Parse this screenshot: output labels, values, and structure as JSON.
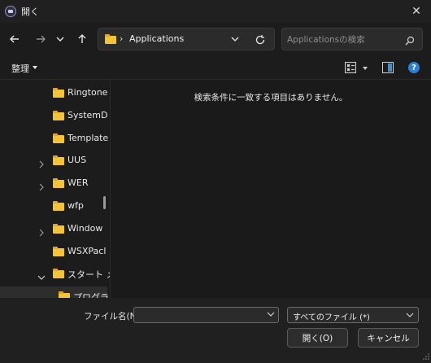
{
  "window": {
    "title": "開く",
    "close_icon": "close-icon"
  },
  "nav": {
    "back_icon": "back-arrow-icon",
    "forward_icon": "forward-arrow-icon",
    "recent_icon": "chevron-down-icon",
    "up_icon": "up-arrow-icon",
    "breadcrumb_sep": "›",
    "breadcrumb": "Applications",
    "search_placeholder": "Applicationsの検索"
  },
  "toolbar": {
    "organize_label": "整理",
    "help_label": "?"
  },
  "sidebar": {
    "items": [
      {
        "label": "Ringtone",
        "expandable": false,
        "expanded": false,
        "indent": 1
      },
      {
        "label": "SystemD",
        "expandable": false,
        "expanded": false,
        "indent": 1
      },
      {
        "label": "Template",
        "expandable": false,
        "expanded": false,
        "indent": 1
      },
      {
        "label": "UUS",
        "expandable": true,
        "expanded": false,
        "indent": 1
      },
      {
        "label": "WER",
        "expandable": true,
        "expanded": false,
        "indent": 1
      },
      {
        "label": "wfp",
        "expandable": false,
        "expanded": false,
        "indent": 1
      },
      {
        "label": "Window",
        "expandable": true,
        "expanded": false,
        "indent": 1
      },
      {
        "label": "WSXPacl",
        "expandable": false,
        "expanded": false,
        "indent": 1
      },
      {
        "label": "スタート メ",
        "expandable": true,
        "expanded": true,
        "indent": 1
      },
      {
        "label": "プログラ",
        "expandable": true,
        "expanded": true,
        "indent": 2
      }
    ]
  },
  "main": {
    "empty_message": "検索条件に一致する項目はありません。"
  },
  "footer": {
    "filename_label": "ファイル名(N):",
    "filename_value": "",
    "filetype_value": "すべてのファイル (*)",
    "open_label": "開く(O)",
    "cancel_label": "キャンセル"
  },
  "colors": {
    "folder": "#f3c338",
    "accent": "#2d7fd1",
    "background": "#202020"
  }
}
